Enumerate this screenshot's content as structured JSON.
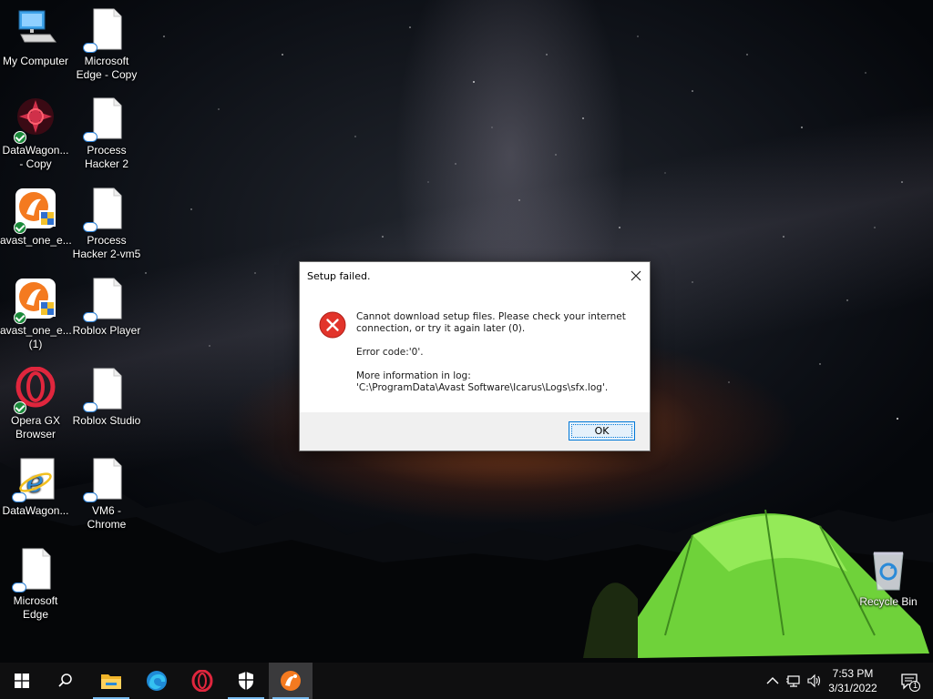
{
  "desktop": {
    "icons_col1": [
      {
        "label": "My Computer"
      },
      {
        "label": "DataWagon... - Copy"
      },
      {
        "label": "avast_one_e..."
      },
      {
        "label": "avast_one_e... (1)"
      },
      {
        "label": "Opera GX Browser"
      },
      {
        "label": "DataWagon..."
      },
      {
        "label": "Microsoft Edge"
      }
    ],
    "icons_col2": [
      {
        "label": "Microsoft Edge - Copy"
      },
      {
        "label": "Process Hacker 2"
      },
      {
        "label": "Process Hacker 2-vm5"
      },
      {
        "label": "Roblox Player"
      },
      {
        "label": "Roblox Studio"
      },
      {
        "label": "VM6 - Chrome"
      }
    ],
    "recycle_bin": {
      "label": "Recycle Bin"
    }
  },
  "dialog": {
    "title": "Setup failed.",
    "message": "Cannot download setup files. Please check your internet connection, or try it again later (0).",
    "error_code": "Error code:'0'.",
    "log_label": "More information in log:",
    "log_path": "'C:\\ProgramData\\Avast Software\\Icarus\\Logs\\sfx.log'.",
    "ok_label": "OK",
    "icon": "error-icon"
  },
  "taskbar": {
    "buttons": [
      "start",
      "search",
      "file-explorer",
      "edge",
      "opera",
      "security",
      "avast"
    ],
    "time": "7:53 PM",
    "date": "3/31/2022",
    "notification_count": "1"
  }
}
